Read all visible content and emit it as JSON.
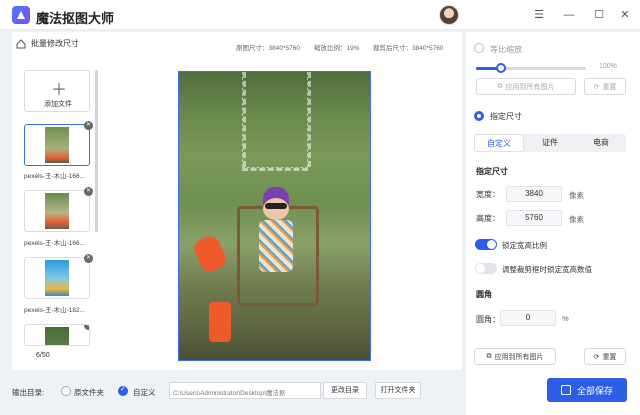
{
  "app": {
    "title": "魔法抠图大师"
  },
  "window": {
    "menu_icon": "menu-icon",
    "minimize_icon": "minimize-icon",
    "maximize_icon": "maximize-icon",
    "close_icon": "close-icon"
  },
  "toolbar": {
    "breadcrumb": "批量修改尺寸",
    "original_size": "原图尺寸：3840*5760",
    "scale_ratio": "缩放比例：19%",
    "cropped_size": "裁剪后尺寸：3840*5760"
  },
  "files": {
    "add_label": "添加文件",
    "items": [
      {
        "name": "pexels-王-木山-166...",
        "selected": true
      },
      {
        "name": "pexels-王-木山-166...",
        "selected": false
      },
      {
        "name": "pexels-王-木山-182...",
        "selected": false
      }
    ],
    "count": "6/50"
  },
  "output": {
    "label": "输出目录:",
    "option_source": "原文件夹",
    "option_custom": "自定义",
    "path": "C:\\Users\\Administrator\\Desktop\\魔法抠",
    "change_button": "更改目录",
    "open_button": "打开文件夹"
  },
  "settings": {
    "proportional_label": "等比缩放",
    "proportional_value": 1.0,
    "proportional_value_text": "100%",
    "apply_all_top": "应用到所有图片",
    "reset_top": "重置",
    "specify_label": "指定尺寸",
    "tabs": [
      "自定义",
      "证件",
      "电商"
    ],
    "active_tab": 0,
    "size_section": "指定尺寸",
    "width_label": "宽度：",
    "width_value": "3840",
    "height_label": "高度：",
    "height_value": "5760",
    "unit_px": "像素",
    "lock_ratio_label": "锁定宽高比例",
    "lock_ratio_on": true,
    "crop_lock_label": "调整裁剪框时锁定宽高数值",
    "crop_lock_on": false,
    "corner_section": "圆角",
    "corner_label": "圆角：",
    "corner_value": "0",
    "corner_unit": "%",
    "apply_all_bottom": "应用到所有图片",
    "reset_bottom": "重置",
    "save_all": "全部保存"
  },
  "colors": {
    "accent": "#2d5ee8",
    "boot": "#ef5a2a",
    "hat": "#7a3fb2"
  }
}
